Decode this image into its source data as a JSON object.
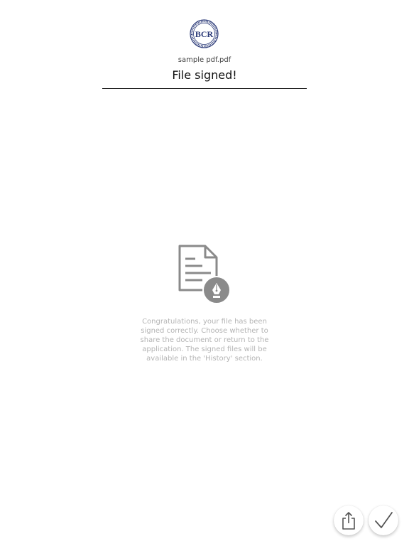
{
  "header": {
    "logo": {
      "icon": "bank-seal-logo-icon",
      "monogram": "BCR",
      "color": "#2b3a78"
    },
    "filename": "sample pdf.pdf",
    "title": "File signed!"
  },
  "main": {
    "icon": "signed-document-icon",
    "message": "Congratulations, your file has been signed correctly. Choose whether to share the document or return to the application. The signed files will be available in the 'History' section."
  },
  "actions": {
    "share": {
      "icon": "share-icon"
    },
    "confirm": {
      "icon": "checkmark-icon"
    }
  },
  "colors": {
    "icon_gray": "#8a8a8a",
    "message_gray": "#b4b4b4"
  }
}
